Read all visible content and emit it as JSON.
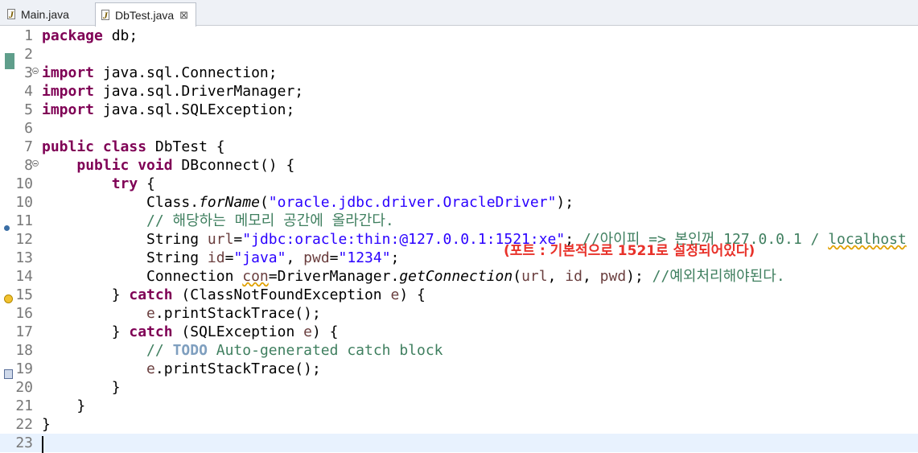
{
  "tabs": [
    {
      "label": "Main.java",
      "active": false
    },
    {
      "label": "DbTest.java",
      "active": true,
      "close_glyph": "⊠"
    }
  ],
  "editor": {
    "current_line": 23,
    "lines": [
      {
        "n": "1",
        "code": "<span class=\"kw\">package</span> db;"
      },
      {
        "n": "2",
        "code": ""
      },
      {
        "n": "3",
        "fold": true,
        "code": "<span class=\"kw\">import</span> java.sql.Connection;"
      },
      {
        "n": "4",
        "code": "<span class=\"kw\">import</span> java.sql.DriverManager;"
      },
      {
        "n": "5",
        "code": "<span class=\"kw\">import</span> java.sql.SQLException;"
      },
      {
        "n": "6",
        "code": ""
      },
      {
        "n": "7",
        "code": "<span class=\"kw\">public class</span> DbTest {"
      },
      {
        "n": "8",
        "fold": true,
        "code": "    <span class=\"kw\">public void</span> DBconnect() {"
      },
      {
        "n": "10",
        "code": "        <span class=\"kw\">try</span> {"
      },
      {
        "n": "10",
        "code": "            Class.<span class=\"it\">forName</span>(<span class=\"str\">\"oracle.jdbc.driver.OracleDriver\"</span>);"
      },
      {
        "n": "11",
        "code": "            <span class=\"cm\">// 해당하는 메모리 공간에 올라간다.</span>"
      },
      {
        "n": "12",
        "code": "            String <span class=\"var\">url</span>=<span class=\"str\">\"jdbc:oracle:thin:@127.0.0.1:1521:xe\"</span>; <span class=\"cm\">//아이피 =&gt; 본인꺼 127.0.0.1 / <span class=\"warn\">localhost</span></span>"
      },
      {
        "n": "13",
        "code": "            String <span class=\"var\">id</span>=<span class=\"str\">\"java\"</span>, <span class=\"var\">pwd</span>=<span class=\"str\">\"1234\"</span>;"
      },
      {
        "n": "14",
        "code": "            Connection <span class=\"var warn\">con</span>=DriverManager.<span class=\"it\">getConnection</span>(<span class=\"var\">url</span>, <span class=\"var\">id</span>, <span class=\"var\">pwd</span>); <span class=\"cm\">//예외처리해야된다.</span>"
      },
      {
        "n": "15",
        "code": "        } <span class=\"kw\">catch</span> (ClassNotFoundException <span class=\"var\">e</span>) {"
      },
      {
        "n": "16",
        "code": "            <span class=\"var\">e</span>.printStackTrace();"
      },
      {
        "n": "17",
        "code": "        } <span class=\"kw\">catch</span> (SQLException <span class=\"var\">e</span>) {"
      },
      {
        "n": "18",
        "code": "            <span class=\"cm\">// <span class=\"todo\">TODO</span> Auto-generated catch block</span>"
      },
      {
        "n": "19",
        "code": "            <span class=\"var\">e</span>.printStackTrace();"
      },
      {
        "n": "20",
        "code": "        }"
      },
      {
        "n": "21",
        "code": "    }"
      },
      {
        "n": "22",
        "code": "}"
      },
      {
        "n": "23",
        "code": ""
      }
    ]
  },
  "annotation": {
    "text": "(포트 : 기본적으로 1521로 설정되어있다)",
    "color": "#e8322a"
  }
}
